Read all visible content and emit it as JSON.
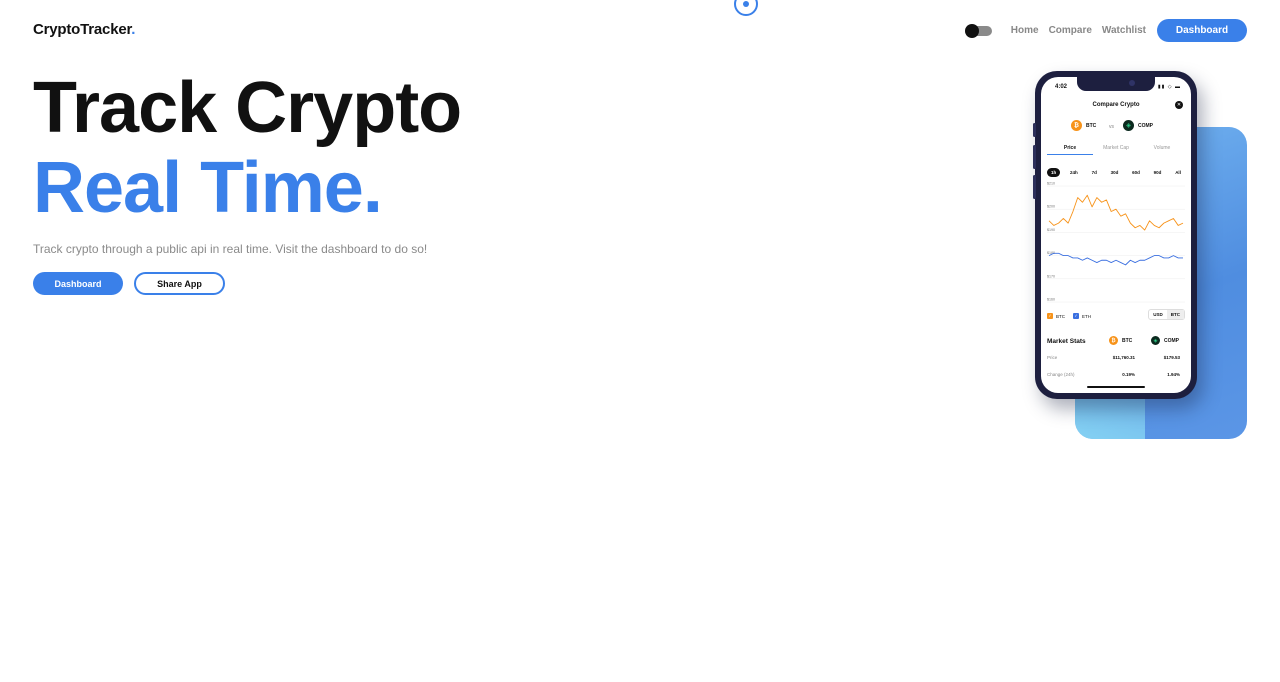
{
  "brand": {
    "name": "CryptoTracker",
    "dot": "."
  },
  "nav": {
    "links": [
      "Home",
      "Compare",
      "Watchlist"
    ],
    "cta": "Dashboard",
    "theme_toggle": "dark"
  },
  "hero": {
    "line1": "Track Crypto",
    "line2": "Real Time.",
    "subtitle": "Track crypto through a public api in real time. Visit the dashboard to do so!",
    "primary_button": "Dashboard",
    "secondary_button": "Share App"
  },
  "colors": {
    "accent": "#3a80e9",
    "text": "#111111",
    "muted": "#8a8a8a",
    "btc": "#f7931a",
    "eth_line": "#3a6fe0"
  },
  "phone": {
    "status_time": "4:02",
    "app_title": "Compare Crypto",
    "coin_a": "BTC",
    "coin_b": "COMP",
    "vs": "vs",
    "tabs": [
      "Price",
      "Market Cap",
      "Volume"
    ],
    "active_tab": "Price",
    "ranges": [
      "1h",
      "24h",
      "7d",
      "30d",
      "60d",
      "90d",
      "All"
    ],
    "active_range": "1h",
    "y_ticks": [
      "$210",
      "$200",
      "$190",
      "$180",
      "$170",
      "$160"
    ],
    "legend": [
      "BTC",
      "ETH"
    ],
    "currency": [
      "USD",
      "BTC"
    ],
    "stats_title": "Market Stats",
    "stats": [
      {
        "label": "Price",
        "a": "$11,760.31",
        "b": "$179.53"
      },
      {
        "label": "Change (24h)",
        "a": "0.19%",
        "b": "1.94%"
      }
    ],
    "chart_series_btc": [
      195,
      193,
      194,
      196,
      194,
      199,
      205,
      203,
      206,
      201,
      205,
      203,
      204,
      199,
      200,
      197,
      198,
      194,
      192,
      193,
      191,
      195,
      193,
      192,
      194,
      195,
      196,
      193,
      194
    ],
    "chart_series_eth": [
      180,
      181,
      181,
      180,
      180,
      179,
      179,
      178,
      179,
      178,
      177,
      178,
      178,
      177,
      178,
      177,
      176,
      178,
      177,
      178,
      178,
      179,
      180,
      180,
      179,
      179,
      180,
      179,
      179
    ]
  }
}
